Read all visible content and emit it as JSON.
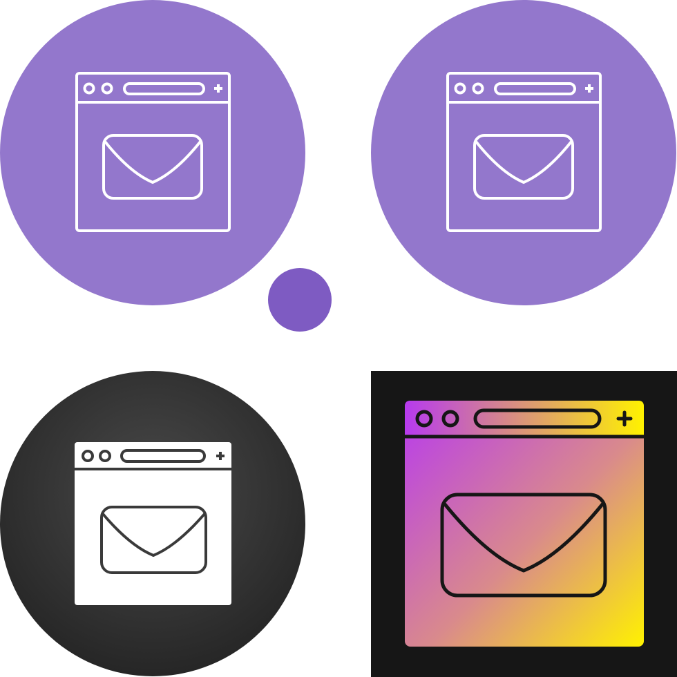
{
  "variants": [
    {
      "style": "line",
      "icon": "browser-mail-icon",
      "background": "purple-circle"
    },
    {
      "style": "line",
      "icon": "browser-mail-icon",
      "background": "purple-circle"
    },
    {
      "style": "glyph",
      "icon": "browser-mail-icon",
      "background": "dark-circle"
    },
    {
      "style": "gradient",
      "icon": "browser-mail-icon",
      "background": "black-square"
    }
  ],
  "colors": {
    "purple_light": "#9377CC",
    "purple_dot": "#7E5BC2",
    "dark_circle_center": "#4A4A4A",
    "dark_circle_edge": "#262626",
    "black_square": "#161616",
    "white": "#FFFFFF",
    "gradient_magenta": "#B73AEF",
    "gradient_pink": "#D98A8C",
    "gradient_yellow": "#FFF200",
    "stroke_dark": "#161616"
  }
}
